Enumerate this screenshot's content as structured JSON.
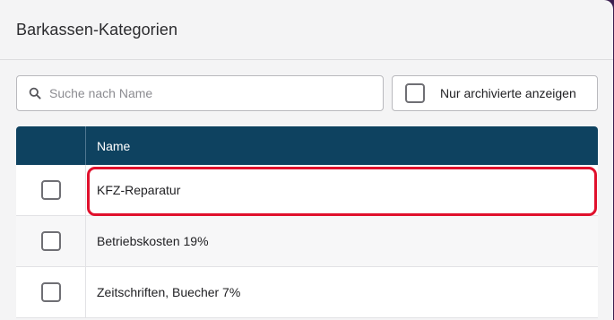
{
  "header": {
    "title": "Barkassen-Kategorien"
  },
  "search": {
    "placeholder": "Suche nach Name",
    "value": "",
    "icon": "search-icon"
  },
  "archive_toggle": {
    "label": "Nur archivierte anzeigen",
    "checked": false
  },
  "table": {
    "columns": [
      "",
      "Name"
    ],
    "rows": [
      {
        "name": "KFZ-Reparatur",
        "checked": false,
        "highlighted": true
      },
      {
        "name": "Betriebskosten 19%",
        "checked": false,
        "highlighted": false
      },
      {
        "name": "Zeitschriften, Buecher 7%",
        "checked": false,
        "highlighted": false
      }
    ]
  },
  "colors": {
    "header_bg": "#0e4260",
    "highlight": "#e0102c",
    "panel_bg": "#f4f4f5"
  }
}
